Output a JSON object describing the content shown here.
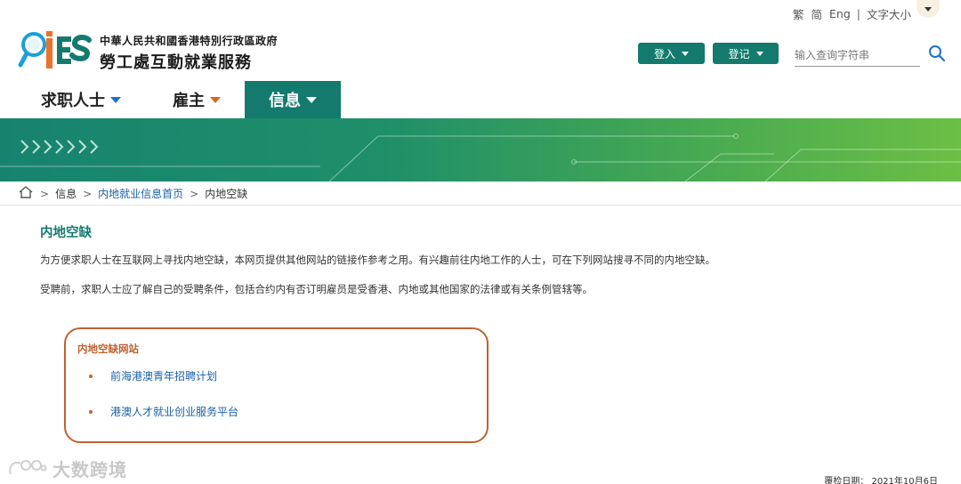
{
  "utility": {
    "trad": "繁",
    "simp": "简",
    "eng": "Eng",
    "font_size": "文字大小"
  },
  "logo": {
    "mark_text": "iES",
    "line1": "中華人民共和國香港特別行政區政府",
    "line2": "勞工處互動就業服務"
  },
  "header": {
    "login_label": "登入",
    "register_label": "登记",
    "search_placeholder": "输入查询字符串"
  },
  "nav": {
    "items": [
      {
        "label": "求职人士",
        "caret_color": "#1a73c9"
      },
      {
        "label": "雇主",
        "caret_color": "#d8661f"
      },
      {
        "label": "信息",
        "caret_color": "#ffffff"
      }
    ]
  },
  "breadcrumb": {
    "items": [
      "信息",
      "内地就业信息首页",
      "内地空缺"
    ]
  },
  "content": {
    "title": "内地空缺",
    "para1": "为方便求职人士在互联网上寻找内地空缺，本网页提供其他网站的链接作参考之用。有兴趣前往内地工作的人士，可在下列网站搜寻不同的内地空缺。",
    "para2": "受聘前，求职人士应了解自己的受聘条件，包括合约内有否订明雇员是受香港、内地或其他国家的法律或有关条例管辖等。"
  },
  "box": {
    "title": "内地空缺网站",
    "links": [
      "前海港澳青年招聘计划",
      "港澳人才就业创业服务平台"
    ]
  },
  "watermark": {
    "text": "大数跨境"
  },
  "footer": {
    "date": "覆检日期： 2021年10月6日"
  },
  "colors": {
    "primary": "#137a6d",
    "accent": "#c0622f",
    "link": "#1a5fa8"
  }
}
